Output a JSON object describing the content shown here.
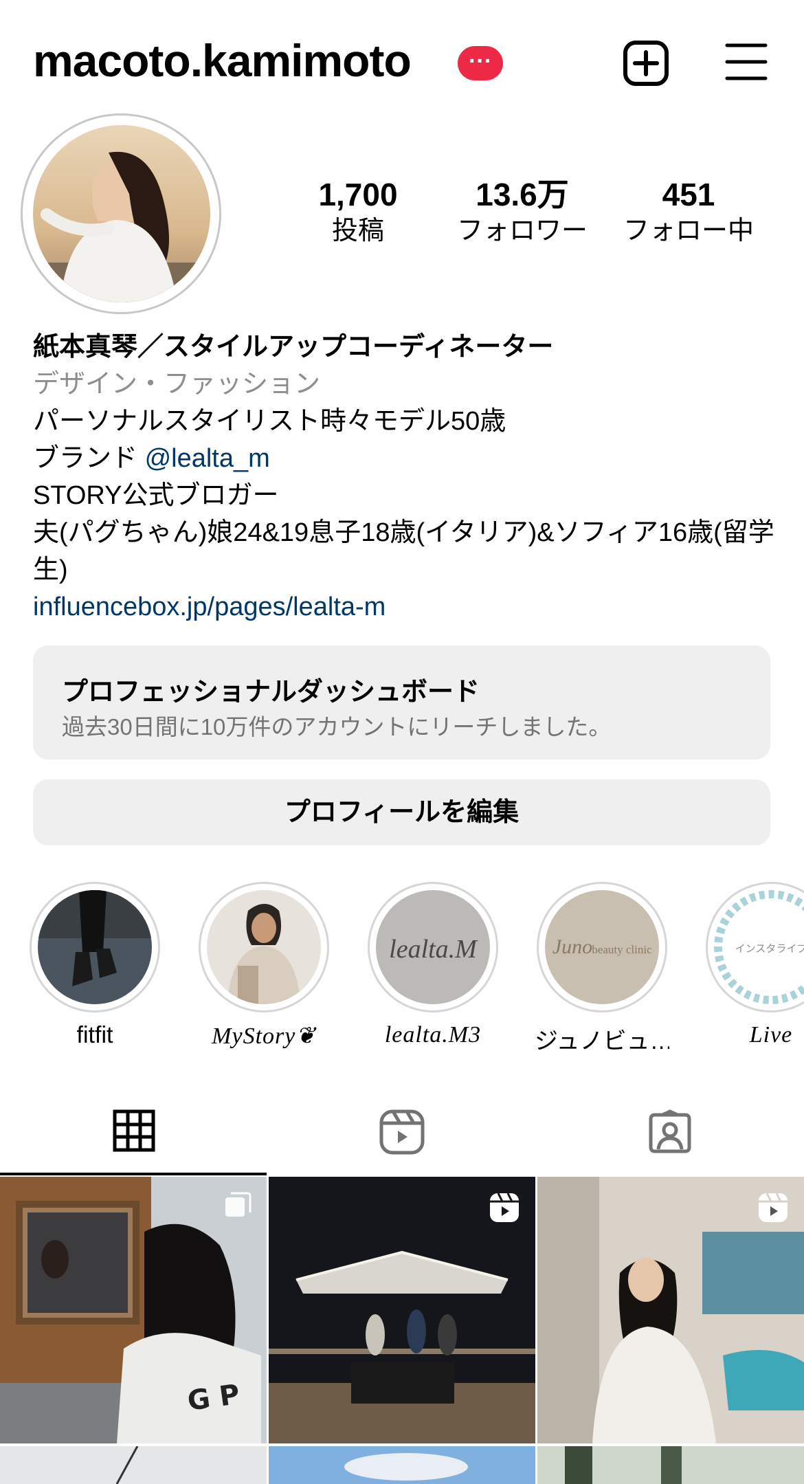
{
  "header": {
    "username": "macoto.kamimoto",
    "badge": "···",
    "new_post_icon": "plus-square-icon",
    "menu_icon": "hamburger-menu-icon"
  },
  "stats": [
    {
      "num": "1,700",
      "label": "投稿"
    },
    {
      "num": "13.6万",
      "label": "フォロワー"
    },
    {
      "num": "451",
      "label": "フォロー中"
    }
  ],
  "bio": {
    "name": "紙本真琴／スタイルアップコーディネーター",
    "category": "デザイン・ファッション",
    "line1": "パーソナルスタイリスト時々モデル50歳",
    "line2_prefix": "ブランド ",
    "line2_mention": "@lealta_m",
    "line3": "STORY公式ブロガー",
    "line4": "夫(パグちゃん)娘24&19息子18歳(イタリア)&ソフィア16歳(留学生)",
    "link": "influencebox.jp/pages/lealta-m"
  },
  "dashboard": {
    "title": "プロフェッショナルダッシュボード",
    "subtitle": "過去30日間に10万件のアカウントにリーチしました。"
  },
  "edit_profile_label": "プロフィールを編集",
  "highlights": [
    {
      "caption": "fitfit"
    },
    {
      "caption": "MyStory❦"
    },
    {
      "caption": "lealta.M3"
    },
    {
      "caption": "ジュノビュ…"
    },
    {
      "caption": "Live"
    }
  ],
  "highlight_pic_text": {
    "lealta": "lealta.M",
    "juno": "Juno",
    "juno_sub": "beauty clinic",
    "insta": "インスタライブ"
  },
  "tabs": [
    {
      "name": "posts",
      "icon": "grid-icon",
      "active": true
    },
    {
      "name": "reels",
      "icon": "reels-icon",
      "active": false
    },
    {
      "name": "tagged",
      "icon": "tagged-person-icon",
      "active": false
    }
  ],
  "grid_posts": [
    {
      "type": "carousel",
      "icon": "carousel-icon"
    },
    {
      "type": "reel",
      "icon": "reel-icon"
    },
    {
      "type": "reel",
      "icon": "reel-icon"
    }
  ],
  "colors": {
    "badge": "#ed2945",
    "link": "#00376b",
    "secondary_text": "#737373",
    "button_bg": "#efefef"
  }
}
